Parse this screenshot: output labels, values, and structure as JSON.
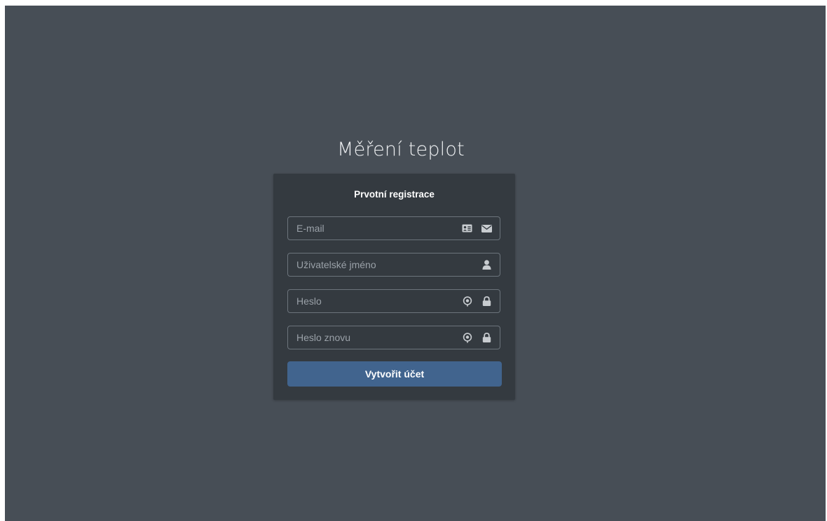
{
  "app": {
    "title": "Měření teplot"
  },
  "form": {
    "title": "Prvotní registrace",
    "fields": [
      {
        "placeholder": "E-mail",
        "value": "",
        "icons": [
          "id-card-icon",
          "envelope-icon"
        ]
      },
      {
        "placeholder": "Uživatelské jméno",
        "value": "",
        "icons": [
          "user-icon"
        ]
      },
      {
        "placeholder": "Heslo",
        "value": "",
        "icons": [
          "password-reveal-icon",
          "lock-icon"
        ]
      },
      {
        "placeholder": "Heslo znovu",
        "value": "",
        "icons": [
          "password-reveal-icon",
          "lock-icon"
        ]
      }
    ],
    "submit_label": "Vytvořit účet"
  },
  "colors": {
    "background": "#474e56",
    "card": "#343a40",
    "field_border": "#6c747c",
    "icon": "#c8ccd0",
    "primary_button": "#41648e"
  }
}
